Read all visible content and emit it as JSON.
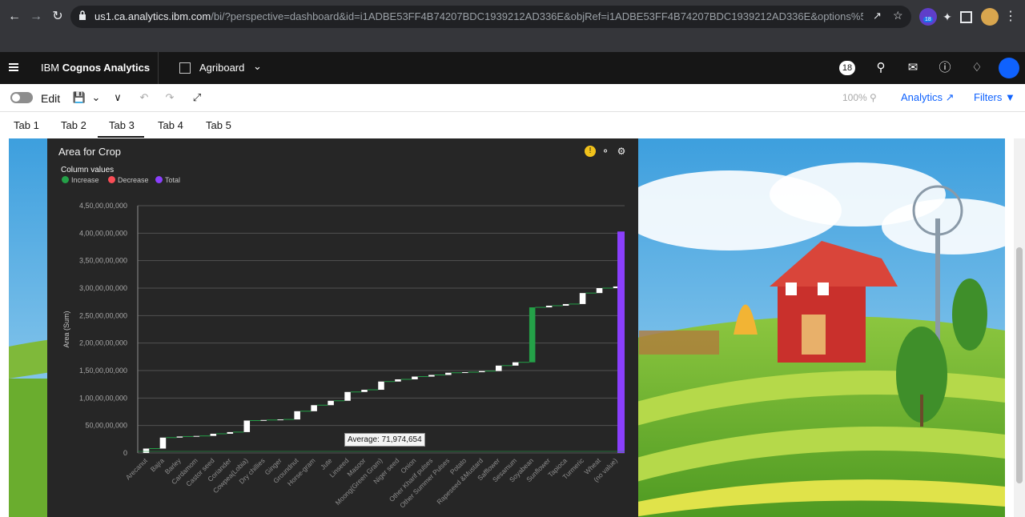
{
  "browser": {
    "url_host": "us1.ca.analytics.ibm.com",
    "url_rest": "/bi/?perspective=dashboard&id=i1ADBE53FF4B74207BDC1939212AD336E&objRef=i1ADBE53FF4B74207BDC1939212AD336E&options%5BdisableGlassPrefetch...",
    "extension_badge": "18"
  },
  "app": {
    "brand_plain": "IBM ",
    "brand_bold": "Cognos Analytics",
    "dashboard_name": "Agriboard",
    "notification_count": "18"
  },
  "toolbar": {
    "edit_label": "Edit",
    "zoom_label": "100%",
    "analytics_label": "Analytics",
    "filters_label": "Filters"
  },
  "tabs": [
    {
      "label": "Tab 1"
    },
    {
      "label": "Tab 2"
    },
    {
      "label": "Tab 3",
      "active": true
    },
    {
      "label": "Tab 4"
    },
    {
      "label": "Tab 5"
    }
  ],
  "chart_panel": {
    "title": "Area for Crop",
    "legend_title": "Column values",
    "legend": [
      {
        "label": "Increase",
        "color": "#24a148"
      },
      {
        "label": "Decrease",
        "color": "#fa4d56"
      },
      {
        "label": "Total",
        "color": "#8a3ffc"
      }
    ],
    "tooltip": "Average: 71,974,654"
  },
  "chart_data": {
    "type": "bar",
    "subtype": "waterfall",
    "title": "Area for Crop",
    "ylabel": "Area (Sum)",
    "xlabel": "",
    "ylim": [
      0,
      450000000
    ],
    "y_ticks": [
      "0",
      "50,00,00,000",
      "1,00,00,000",
      "1,50,00,000"
    ],
    "y_tick_labels": [
      "0",
      "50,00,00,000",
      "1,00,00,00,000",
      "1,50,00,00,000",
      "2,00,00,00,000",
      "2,50,00,00,000",
      "3,00,00,00,000",
      "3,50,00,00,000",
      "4,00,00,00,000",
      "4,50,00,00,000"
    ],
    "y_tick_values": [
      0,
      50000000,
      100000000,
      150000000,
      200000000,
      250000000,
      300000000,
      350000000,
      400000000,
      450000000
    ],
    "categories": [
      "Arecanut",
      "Bajra",
      "Barley",
      "Cardamom",
      "Castor seed",
      "Coriander",
      "Cowpea(Lobia)",
      "Dry chillies",
      "Ginger",
      "Groundnut",
      "Horse-gram",
      "Jute",
      "Linseed",
      "Masoor",
      "Moong(Green Gram)",
      "Niger seed",
      "Onion",
      "Other Kharif pulses",
      "Other Summer Pulses",
      "Potato",
      "Rapeseed &Mustard",
      "Safflower",
      "Sesamum",
      "Soyabean",
      "Sunflower",
      "Tapioca",
      "Turmeric",
      "Wheat",
      "(no value)"
    ],
    "values": [
      8000000,
      20000000,
      2000000,
      1000000,
      4000000,
      3000000,
      21000000,
      1000000,
      1000000,
      15000000,
      11000000,
      8000000,
      16000000,
      4000000,
      15000000,
      4000000,
      5000000,
      3000000,
      4000000,
      1000000,
      2000000,
      10000000,
      6000000,
      100000000,
      3000000,
      3000000,
      20000000,
      9000000,
      3000000
    ],
    "start_values": [
      0,
      8000000,
      28000000,
      30000000,
      31000000,
      35000000,
      38000000,
      59000000,
      60000000,
      61000000,
      76000000,
      87000000,
      95000000,
      111000000,
      115000000,
      130000000,
      134000000,
      139000000,
      142000000,
      146000000,
      147000000,
      149000000,
      159000000,
      165000000,
      265000000,
      268000000,
      271000000,
      291000000,
      300000000
    ],
    "total": 403000000,
    "average_line": 71974654,
    "colors": {
      "increase": "#24a148",
      "decrease": "#fa4d56",
      "total": "#8a3ffc",
      "highlight": "#ffffff"
    }
  }
}
